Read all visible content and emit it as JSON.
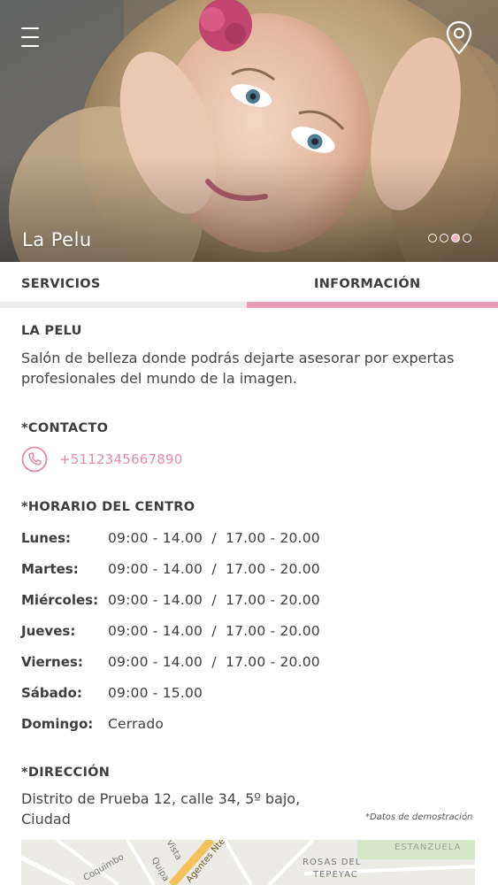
{
  "hero": {
    "title": "La Pelu",
    "slides_total": 4,
    "slide_active": 3
  },
  "icons": {
    "menu": "hamburger-menu-icon",
    "location": "map-pin-icon",
    "phone": "phone-icon"
  },
  "tabs": [
    {
      "label": "SERVICIOS",
      "active": false
    },
    {
      "label": "INFORMACIÓN",
      "active": true
    }
  ],
  "colors": {
    "accent": "#eb9bb3",
    "phone_text": "#e48aa8",
    "tab_inactive_bar": "#ececec"
  },
  "info": {
    "salon_title": "LA PELU",
    "description": "Salón de belleza donde podrás dejarte asesorar por expertas profesionales del mundo de la imagen.",
    "contact_title": "*CONTACTO",
    "phone": "+5112345667890",
    "hours_title": "*HORARIO DEL CENTRO",
    "hours": [
      {
        "day": "Lunes:",
        "value": "09:00 - 14.00  /  17.00 - 20.00"
      },
      {
        "day": "Martes:",
        "value": "09:00 - 14.00  /  17.00 - 20.00"
      },
      {
        "day": "Miércoles:",
        "value": "09:00 - 14.00  /  17.00 - 20.00"
      },
      {
        "day": "Jueves:",
        "value": "09:00 - 14.00  /  17.00 - 20.00"
      },
      {
        "day": "Viernes:",
        "value": "09:00 - 14.00  /  17.00 - 20.00"
      },
      {
        "day": "Sábado:",
        "value": "09:00 - 15.00"
      },
      {
        "day": "Domingo:",
        "value": "Cerrado"
      }
    ],
    "address_title": "*DIRECCIÓN",
    "address": "Distrito de Prueba 12, calle 34, 5º bajo, Ciudad",
    "demo_note": "*Datos de demostración"
  },
  "map": {
    "labels": [
      "Coquimbo",
      "ESTANZUELA",
      "ROSAS DEL",
      "TEPEYAC",
      "Vista",
      "Quipa",
      "Agentes Nte"
    ]
  }
}
